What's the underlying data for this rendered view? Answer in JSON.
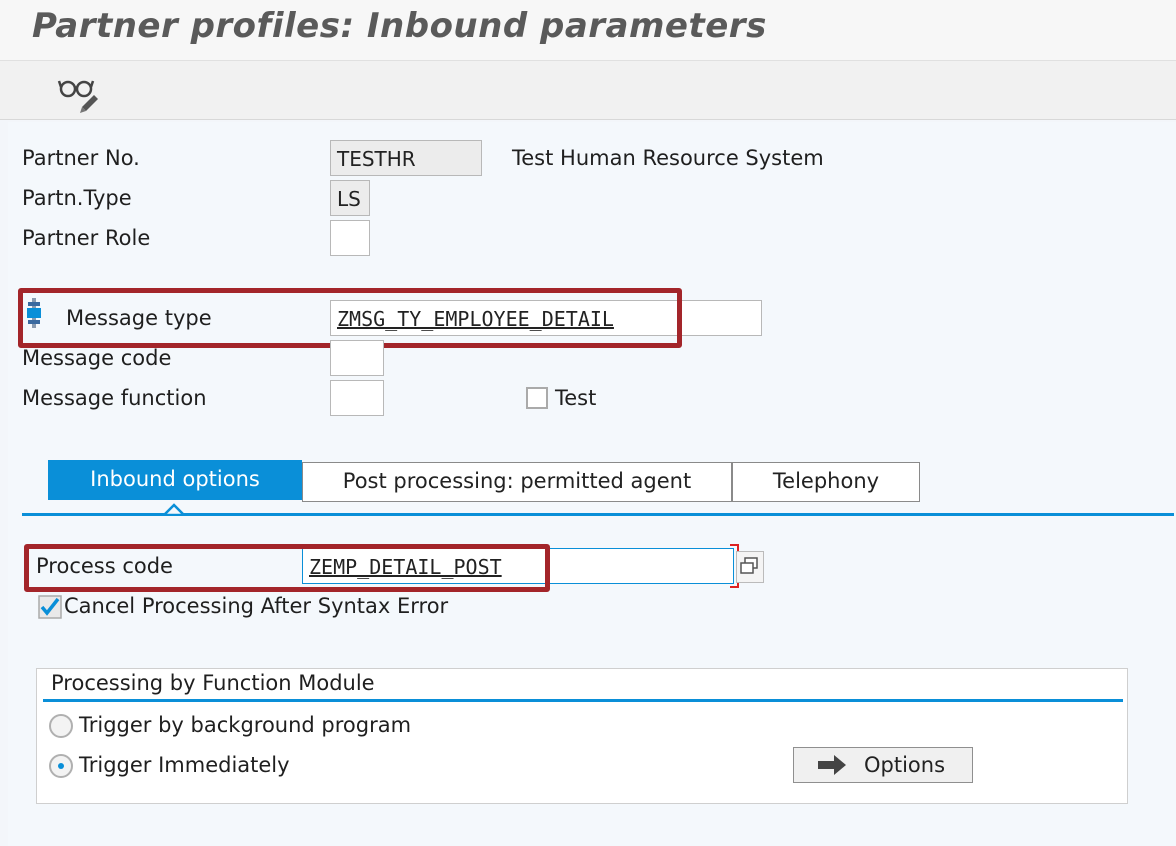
{
  "window": {
    "title": "Partner profiles: Inbound parameters"
  },
  "toolbar": {
    "display_change_icon": "glasses-pencil-icon"
  },
  "header": {
    "partner_no": {
      "label": "Partner No.",
      "value": "TESTHR",
      "description": "Test Human Resource System"
    },
    "partner_type": {
      "label": "Partn.Type",
      "value": "LS"
    },
    "partner_role": {
      "label": "Partner Role",
      "value": ""
    },
    "message_type": {
      "label": "Message type",
      "value": "ZMSG_TY_EMPLOYEE_DETAIL"
    },
    "message_code": {
      "label": "Message code",
      "value": ""
    },
    "message_function": {
      "label": "Message function",
      "value": ""
    },
    "test": {
      "label": "Test",
      "checked": false
    }
  },
  "tabs": [
    {
      "label": "Inbound options",
      "active": true
    },
    {
      "label": "Post processing: permitted agent",
      "active": false
    },
    {
      "label": "Telephony",
      "active": false
    }
  ],
  "inbound": {
    "process_code": {
      "label": "Process code",
      "value": "ZEMP_DETAIL_POST"
    },
    "cancel_after_syntax_error": {
      "label": "Cancel Processing After Syntax Error",
      "checked": true
    },
    "group": {
      "title": "Processing by Function Module",
      "options": [
        {
          "label": "Trigger by background program",
          "selected": false
        },
        {
          "label": "Trigger Immediately",
          "selected": true
        }
      ],
      "options_button": "Options"
    }
  },
  "colors": {
    "accent": "#0a8fd8",
    "highlight": "#a3252a"
  }
}
